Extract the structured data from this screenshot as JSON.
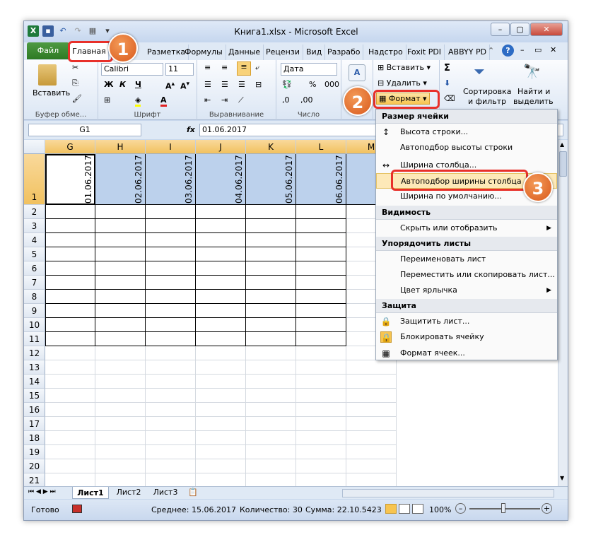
{
  "window": {
    "title": "Книга1.xlsx - Microsoft Excel"
  },
  "tabs": [
    "Файл",
    "Главная",
    "Разметка",
    "Формулы",
    "Данные",
    "Рецензи",
    "Вид",
    "Разрабо",
    "Надстро",
    "Foxit PDI",
    "ABBYY PD"
  ],
  "ribbon": {
    "paste": "Вставить",
    "clipboard": "Буфер обме...",
    "font_name": "Calibri",
    "font_size": "11",
    "font_group": "Шрифт",
    "align_group": "Выравнивание",
    "number_format": "Дата",
    "number_group": "Число",
    "insert": "Вставить",
    "delete": "Удалить",
    "format": "Формат",
    "sort1": "Сортировка",
    "sort2": "и фильтр",
    "find1": "Найти и",
    "find2": "выделить",
    "bold": "Ж",
    "italic": "К",
    "underline": "Ч",
    "fontcolor": "А",
    "sigma": "Σ"
  },
  "formula_bar": {
    "name_box": "G1",
    "fx": "fx",
    "value": "01.06.2017"
  },
  "grid": {
    "columns": [
      "G",
      "H",
      "I",
      "J",
      "K",
      "L",
      "M"
    ],
    "rows": [
      "1",
      "2",
      "3",
      "4",
      "5",
      "6",
      "7",
      "8",
      "9",
      "10",
      "11",
      "12",
      "13",
      "14",
      "15",
      "16",
      "17",
      "18",
      "19",
      "20",
      "21"
    ],
    "header_values": [
      "01.06.2017",
      "02.06.2017",
      "03.06.2017",
      "04.06.2017",
      "05.06.2017",
      "06.06.2017"
    ]
  },
  "menu": {
    "h1": "Размер ячейки",
    "row_height": "Высота строки...",
    "autofit_row": "Автоподбор высоты строки",
    "col_width": "Ширина столбца...",
    "autofit_col": "Автоподбор ширины столбца",
    "default_width": "Ширина по умолчанию...",
    "h2": "Видимость",
    "hide_show": "Скрыть или отобразить",
    "h3": "Упорядочить листы",
    "rename": "Переименовать лист",
    "move_copy": "Переместить или скопировать лист...",
    "tab_color": "Цвет ярлычка",
    "h4": "Защита",
    "protect": "Защитить лист...",
    "lock": "Блокировать ячейку",
    "format_cells": "Формат ячеек..."
  },
  "sheets": [
    "Лист1",
    "Лист2",
    "Лист3"
  ],
  "status": {
    "ready": "Готово",
    "avg": "Среднее: 15.06.2017",
    "count": "Количество: 30",
    "sum": "Сумма: 22.10.5423",
    "zoom": "100%"
  },
  "callouts": [
    "1",
    "2",
    "3"
  ]
}
